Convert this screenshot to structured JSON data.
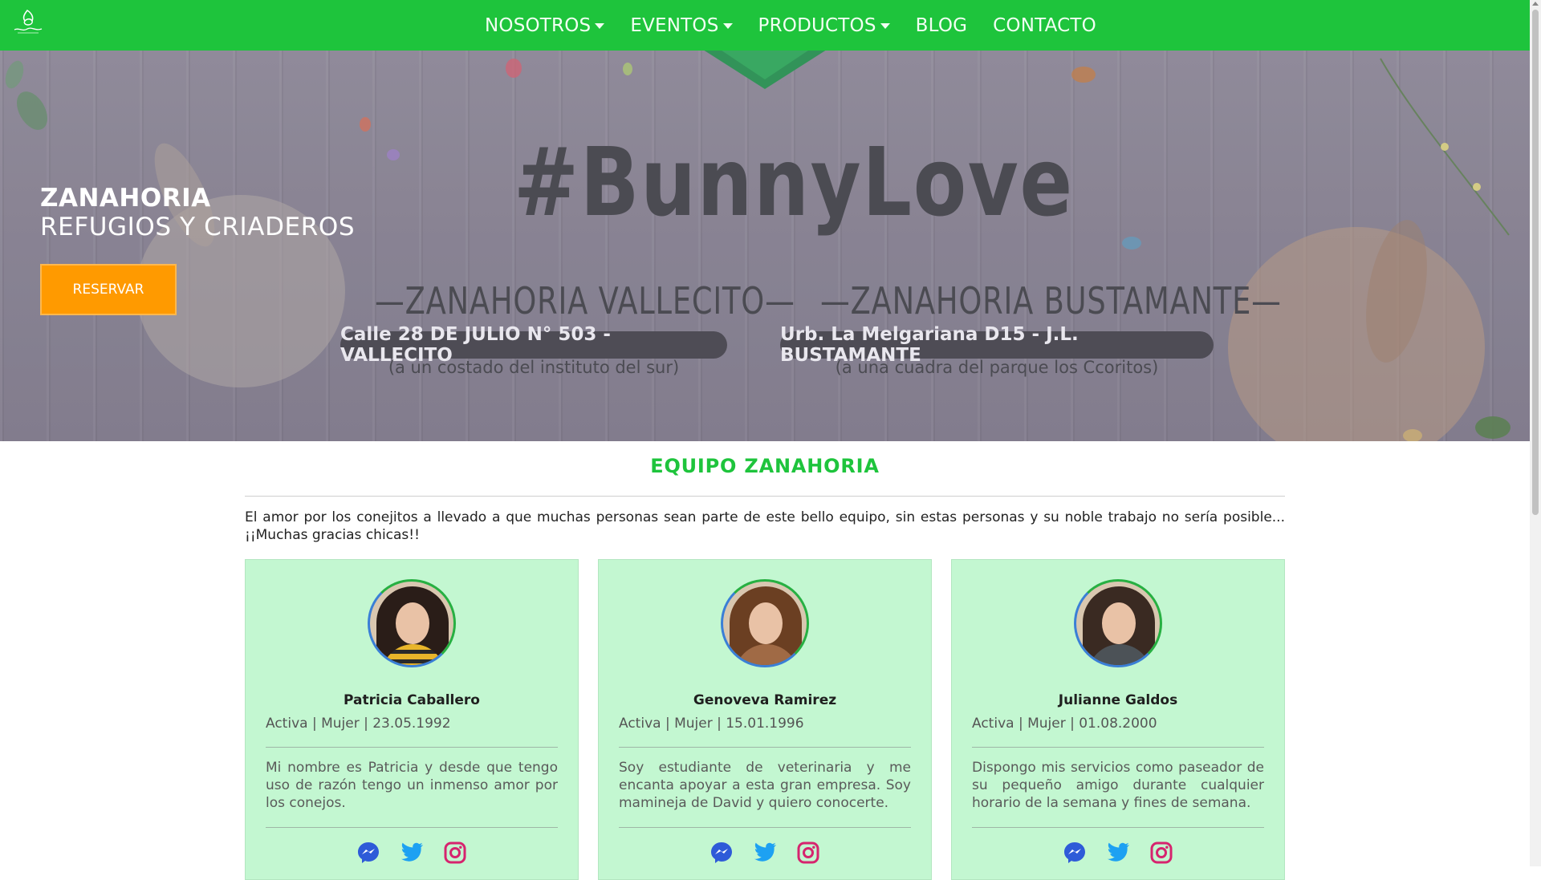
{
  "nav": {
    "logo_label": "Zanahoria",
    "items": [
      {
        "label": "NOSOTROS",
        "dropdown": true
      },
      {
        "label": "EVENTOS",
        "dropdown": true
      },
      {
        "label": "PRODUCTOS",
        "dropdown": true
      },
      {
        "label": "BLOG",
        "dropdown": false
      },
      {
        "label": "CONTACTO",
        "dropdown": false
      }
    ]
  },
  "hero": {
    "title": "ZANAHORIA",
    "subtitle": "REFUGIOS Y CRIADEROS",
    "button": "RESERVAR",
    "hashtag": "#BunnyLove",
    "branches": [
      {
        "name": "—ZANAHORIA VALLECITO—",
        "address": "Calle 28 DE JULIO N° 503 - VALLECITO",
        "note": "(a un costado del instituto del sur)"
      },
      {
        "name": "—ZANAHORIA BUSTAMANTE—",
        "address": "Urb. La Melgariana D15 - J.L. BUSTAMANTE",
        "note": "(a una cuadra del parque los Ccoritos)"
      }
    ]
  },
  "team": {
    "title": "EQUIPO ZANAHORIA",
    "intro": "El amor por los conejitos a llevado a que muchas personas sean parte de este bello equipo, sin estas personas y su noble trabajo no sería posible... ¡¡Muchas gracias chicas!!",
    "members": [
      {
        "name": "Patricia Caballero",
        "meta": "Activa | Mujer | 23.05.1992",
        "bio": "Mi nombre es Patricia y desde que tengo uso de razón tengo un inmenso amor por los conejos."
      },
      {
        "name": "Genoveva Ramirez",
        "meta": "Activa | Mujer | 15.01.1996",
        "bio": "Soy estudiante de veterinaria y me encanta apoyar a esta gran empresa. Soy mamineja de David y quiero conocerte."
      },
      {
        "name": "Julianne Galdos",
        "meta": "Activa | Mujer | 01.08.2000",
        "bio": "Dispongo mis servicios como paseador de su pequeño amigo durante cualquier horario de la semana y fines de semana."
      }
    ],
    "social_icons": [
      "messenger-icon",
      "twitter-icon",
      "instagram-icon"
    ]
  },
  "colors": {
    "brand_green": "#1ec43c",
    "button_orange": "#ff9a00",
    "card_bg": "#c3f7d1",
    "messenger_blue": "#2e5bd8",
    "twitter_blue": "#1da1f2",
    "instagram_pink": "#d6246e"
  }
}
